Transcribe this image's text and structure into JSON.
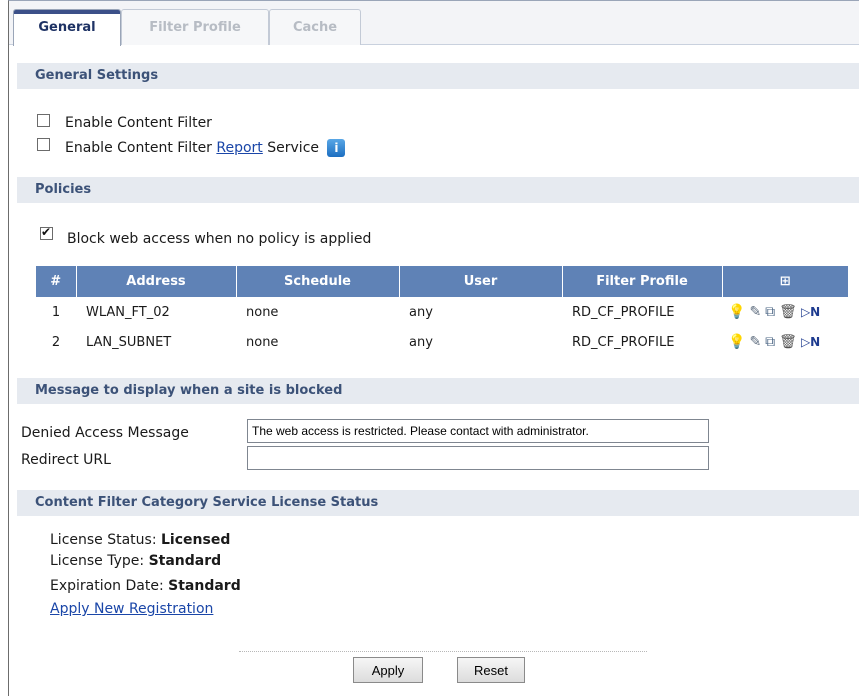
{
  "tabs": [
    {
      "label": "General",
      "active": true
    },
    {
      "label": "Filter Profile",
      "active": false
    },
    {
      "label": "Cache",
      "active": false
    }
  ],
  "general_settings": {
    "title": "General Settings",
    "enable_content_filter": {
      "label": "Enable Content Filter",
      "checked": false
    },
    "enable_report_service": {
      "label_before": "Enable Content Filter ",
      "link": "Report",
      "label_after": " Service",
      "checked": false
    }
  },
  "policies": {
    "title": "Policies",
    "block_access": {
      "label": "Block web access when no policy is applied",
      "checked": true
    },
    "columns": [
      "#",
      "Address",
      "Schedule",
      "User",
      "Filter Profile"
    ],
    "rows": [
      {
        "num": "1",
        "address": "WLAN_FT_02",
        "schedule": "none",
        "user": "any",
        "profile": "RD_CF_PROFILE"
      },
      {
        "num": "2",
        "address": "LAN_SUBNET",
        "schedule": "none",
        "user": "any",
        "profile": "RD_CF_PROFILE"
      }
    ],
    "action_icons": [
      "status-bulb-icon",
      "edit-icon",
      "references-icon",
      "delete-icon",
      "move-icon"
    ]
  },
  "message": {
    "title": "Message to display when a site is blocked",
    "denied_label": "Denied Access Message",
    "denied_value": "The web access is restricted. Please contact with administrator.",
    "redirect_label": "Redirect URL",
    "redirect_value": ""
  },
  "license": {
    "title": "Content Filter Category Service License Status",
    "status_label": "License Status: ",
    "status_value": "Licensed",
    "type_label": "License Type: ",
    "type_value": "Standard",
    "expiration_label": "Expiration Date: ",
    "expiration_value": "Standard",
    "apply_link": "Apply New Registration"
  },
  "buttons": {
    "apply": "Apply",
    "reset": "Reset"
  },
  "colors": {
    "header_row": "#5f82b6",
    "section_bg": "#e6eaf0",
    "section_text": "#3c5278",
    "link": "#1a46a8"
  }
}
